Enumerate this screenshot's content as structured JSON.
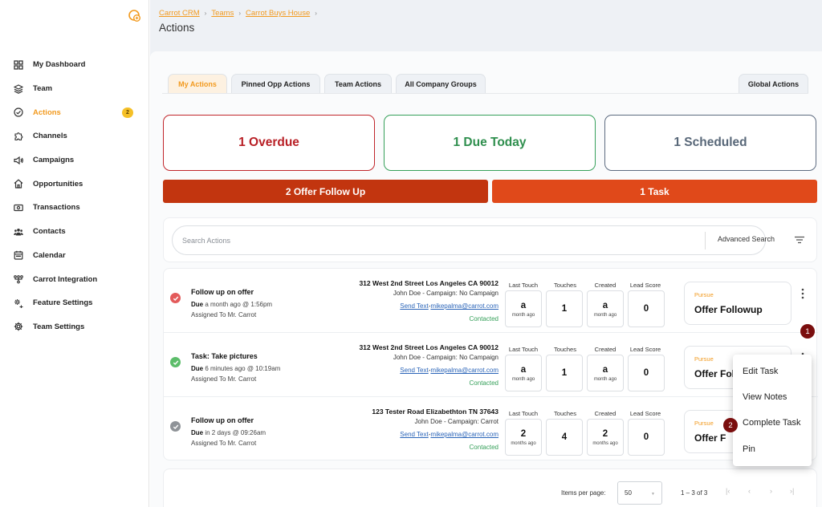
{
  "breadcrumb": [
    "Carrot CRM",
    "Teams",
    "Carrot Buys House"
  ],
  "page_title": "Actions",
  "sidebar": {
    "items": [
      {
        "label": "My Dashboard",
        "icon": "dashboard-icon"
      },
      {
        "label": "Team",
        "icon": "layers-icon"
      },
      {
        "label": "Actions",
        "icon": "check-circle-icon",
        "badge": "2"
      },
      {
        "label": "Channels",
        "icon": "puzzle-icon"
      },
      {
        "label": "Campaigns",
        "icon": "megaphone-icon"
      },
      {
        "label": "Opportunities",
        "icon": "house-icon"
      },
      {
        "label": "Transactions",
        "icon": "money-icon"
      },
      {
        "label": "Contacts",
        "icon": "people-icon"
      },
      {
        "label": "Calendar",
        "icon": "calendar-icon"
      },
      {
        "label": "Carrot Integration",
        "icon": "integration-icon"
      },
      {
        "label": "Feature Settings",
        "icon": "gear-sliders-icon"
      },
      {
        "label": "Team Settings",
        "icon": "gear-icon"
      }
    ]
  },
  "tabs": [
    "My Actions",
    "Pinned Opp Actions",
    "Team Actions",
    "All Company Groups",
    "Global Actions"
  ],
  "status": {
    "overdue": "1 Overdue",
    "today": "1 Due Today",
    "scheduled": "1 Scheduled"
  },
  "types": {
    "offer": "2  Offer Follow Up",
    "task": "1 Task"
  },
  "search": {
    "placeholder": "Search Actions",
    "advanced": "Advanced Search"
  },
  "stat_labels": {
    "last_touch": "Last Touch",
    "touches": "Touches",
    "created": "Created",
    "lead_score": "Lead Score"
  },
  "rows": [
    {
      "title": "Follow up on offer",
      "due_label": "Due",
      "due_text": " a month ago @ 1:56pm",
      "assigned": "Assigned To Mr. Carrot",
      "address": "312 West 2nd Street Los Angeles CA 90012",
      "campaign": "John Doe - Campaign: No Campaign",
      "send_text": "Send Text",
      "dash": "-",
      "email": "mikepalma@carrot.com",
      "contacted": "Contacted",
      "last_touch": {
        "big": "a",
        "small": "month ago"
      },
      "touches": "1",
      "created": {
        "big": "a",
        "small": "month ago"
      },
      "lead_score": "0",
      "stage": "Pursue",
      "stage_name": "Offer Followup",
      "status_color": "#e35b5b"
    },
    {
      "title": "Task: Take pictures",
      "due_label": "Due",
      "due_text": " 6 minutes ago @ 10:19am",
      "assigned": "Assigned To Mr. Carrot",
      "address": "312 West 2nd Street Los Angeles CA 90012",
      "campaign": "John Doe - Campaign: No Campaign",
      "send_text": "Send Text",
      "dash": "-",
      "email": "mikepalma@carrot.com",
      "contacted": "Contacted",
      "last_touch": {
        "big": "a",
        "small": "month ago"
      },
      "touches": "1",
      "created": {
        "big": "a",
        "small": "month ago"
      },
      "lead_score": "0",
      "stage": "Pursue",
      "stage_name": "Offer Foll",
      "status_color": "#5cbd6a"
    },
    {
      "title": "Follow up on offer",
      "due_label": "Due",
      "due_text": " in 2 days @ 09:26am",
      "assigned": "Assigned To Mr. Carrot",
      "address": "123 Tester Road Elizabethton TN 37643",
      "campaign": "John Doe - Campaign: Carrot",
      "send_text": "Send Text",
      "dash": "-",
      "email": "mikepalma@carrot.com",
      "contacted": "Contacted",
      "last_touch": {
        "big": "2",
        "small": "months ago"
      },
      "touches": "4",
      "created": {
        "big": "2",
        "small": "months ago"
      },
      "lead_score": "0",
      "stage": "Pursue",
      "stage_name": "Offer F",
      "status_color": "#8f9398"
    }
  ],
  "pagination": {
    "label": "Items per page:",
    "value": "50",
    "range": "1 – 3 of 3"
  },
  "menu": [
    "Edit Task",
    "View Notes",
    "Complete Task",
    "Pin"
  ],
  "steps": [
    "1",
    "2"
  ],
  "colors": {
    "accent": "#f29a1f",
    "offer_bar": "#c2350f",
    "task_bar": "#e0491a",
    "overdue": "#c0262b",
    "today": "#36a05a",
    "scheduled": "#5d6b80"
  }
}
